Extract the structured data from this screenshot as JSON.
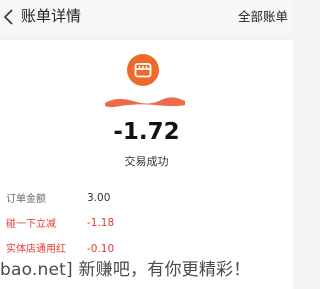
{
  "header": {
    "title": "账单详情",
    "all_bills_label": "全部账单"
  },
  "transaction": {
    "amount": "-1.72",
    "status": "交易成功"
  },
  "details": [
    {
      "label": "订单金额",
      "value": "3.00"
    },
    {
      "label": "碰一下立减",
      "value": "-1.18"
    },
    {
      "label": "实体店通用红",
      "value": "-0.10"
    }
  ],
  "overlay": {
    "watermark_text": "bao.net] 新赚吧，有你更精彩！"
  },
  "colors": {
    "accent_orange": "#ee6a2c",
    "discount_red": "#e53935"
  },
  "icons": {
    "back": "chevron-left-icon",
    "merchant": "shop-icon"
  }
}
